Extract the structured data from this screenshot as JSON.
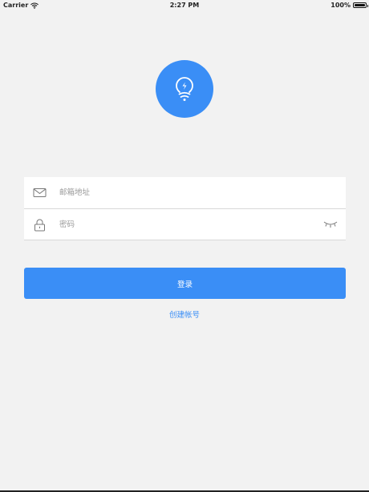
{
  "status_bar": {
    "carrier": "Carrier",
    "time": "2:27 PM",
    "battery": "100%"
  },
  "icons": {
    "logo": "lightbulb-wifi-icon",
    "email": "envelope-icon",
    "password": "lock-icon",
    "toggle": "closed-eye-icon"
  },
  "colors": {
    "accent": "#3a8ef6",
    "background": "#f2f2f2"
  },
  "form": {
    "email_placeholder": "邮箱地址",
    "email_value": "",
    "password_placeholder": "密码",
    "password_value": ""
  },
  "actions": {
    "login_label": "登录",
    "create_account_label": "创建帐号"
  }
}
